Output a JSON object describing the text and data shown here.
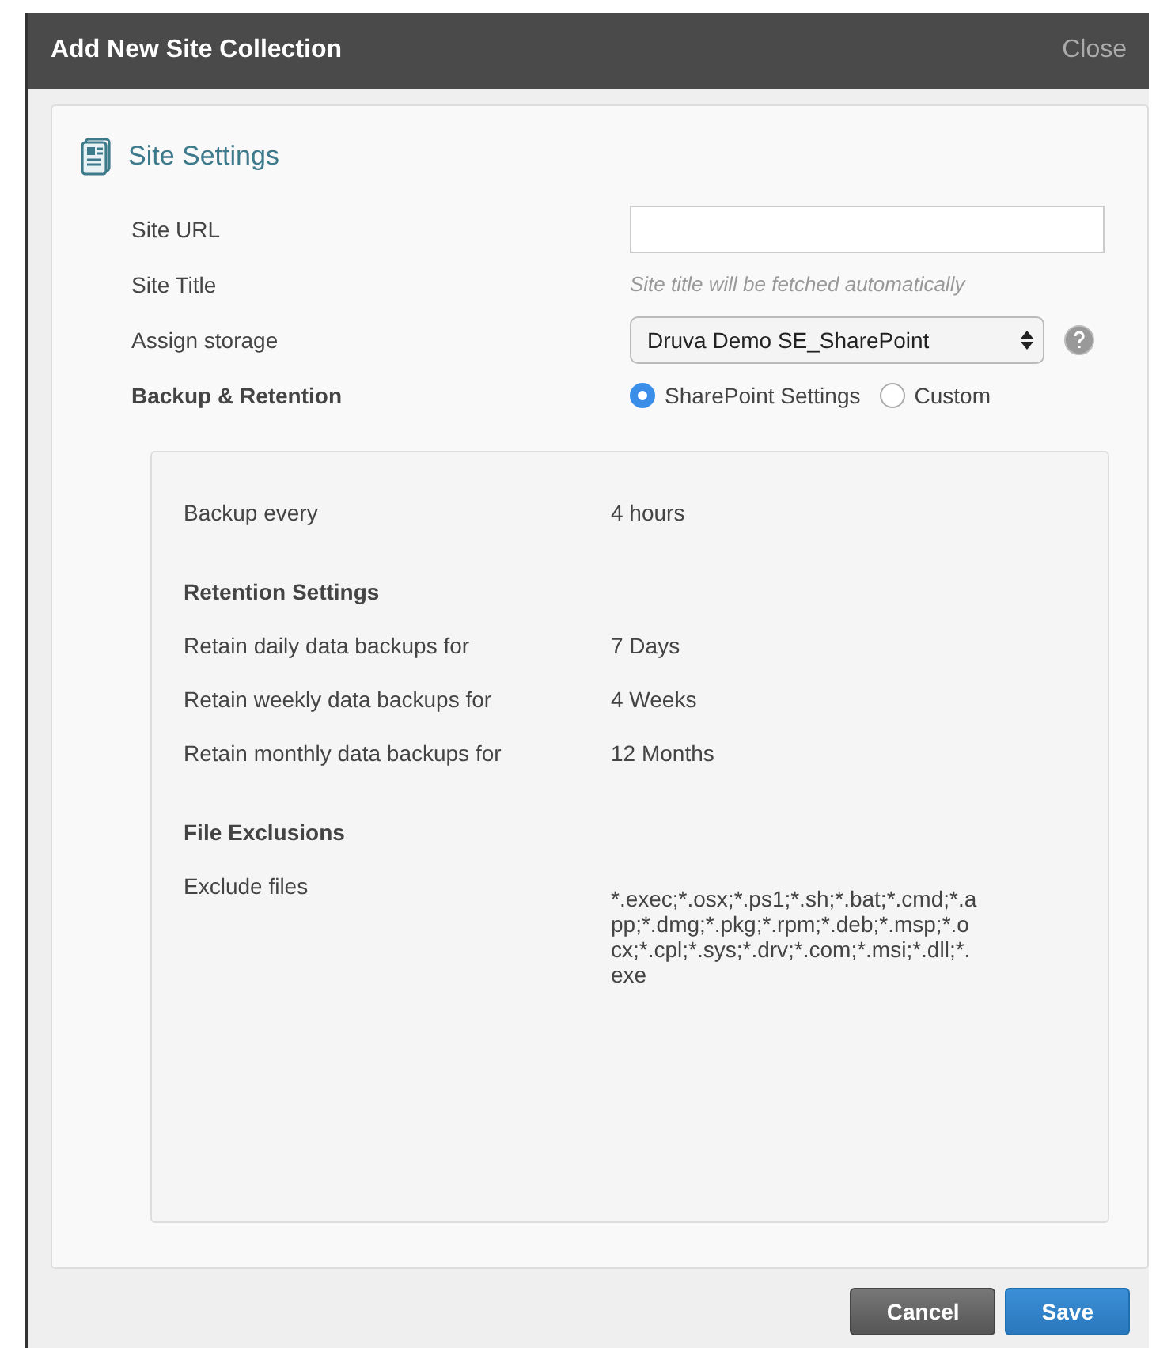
{
  "dialog": {
    "title": "Add New Site Collection",
    "close": "Close"
  },
  "section": {
    "title": "Site Settings"
  },
  "fields": [
    {
      "kind": "input",
      "label": "Site URL"
    },
    {
      "kind": "hint",
      "label": "Site Title",
      "hint": "Site title will be fetched automatically"
    },
    {
      "kind": "select",
      "label": "Assign storage",
      "value": "Druva Demo SE_SharePoint"
    }
  ],
  "backup_retention": {
    "label": "Backup & Retention",
    "options": [
      {
        "label": "SharePoint Settings",
        "selected": true
      },
      {
        "label": "Custom",
        "selected": false
      }
    ]
  },
  "policy": [
    {
      "kind": "row",
      "label": "Backup every",
      "value": "4 hours"
    },
    {
      "kind": "heading",
      "label": "Retention Settings"
    },
    {
      "kind": "row",
      "label": "Retain daily data backups for",
      "value": "7 Days"
    },
    {
      "kind": "row",
      "label": "Retain weekly data backups for",
      "value": "4 Weeks"
    },
    {
      "kind": "row",
      "label": "Retain monthly data backups for",
      "value": "12 Months"
    },
    {
      "kind": "heading",
      "label": "File Exclusions"
    },
    {
      "kind": "wrap",
      "label": "Exclude files",
      "value": "*.exec;*.osx;*.ps1;*.sh;*.bat;*.cmd;*.app;*.dmg;*.pkg;*.rpm;*.deb;*.msp;*.ocx;*.cpl;*.sys;*.drv;*.com;*.msi;*.dll;*.exe"
    }
  ],
  "buttons": [
    {
      "kind": "secondary",
      "label": "Cancel"
    },
    {
      "kind": "primary",
      "label": "Save"
    }
  ]
}
